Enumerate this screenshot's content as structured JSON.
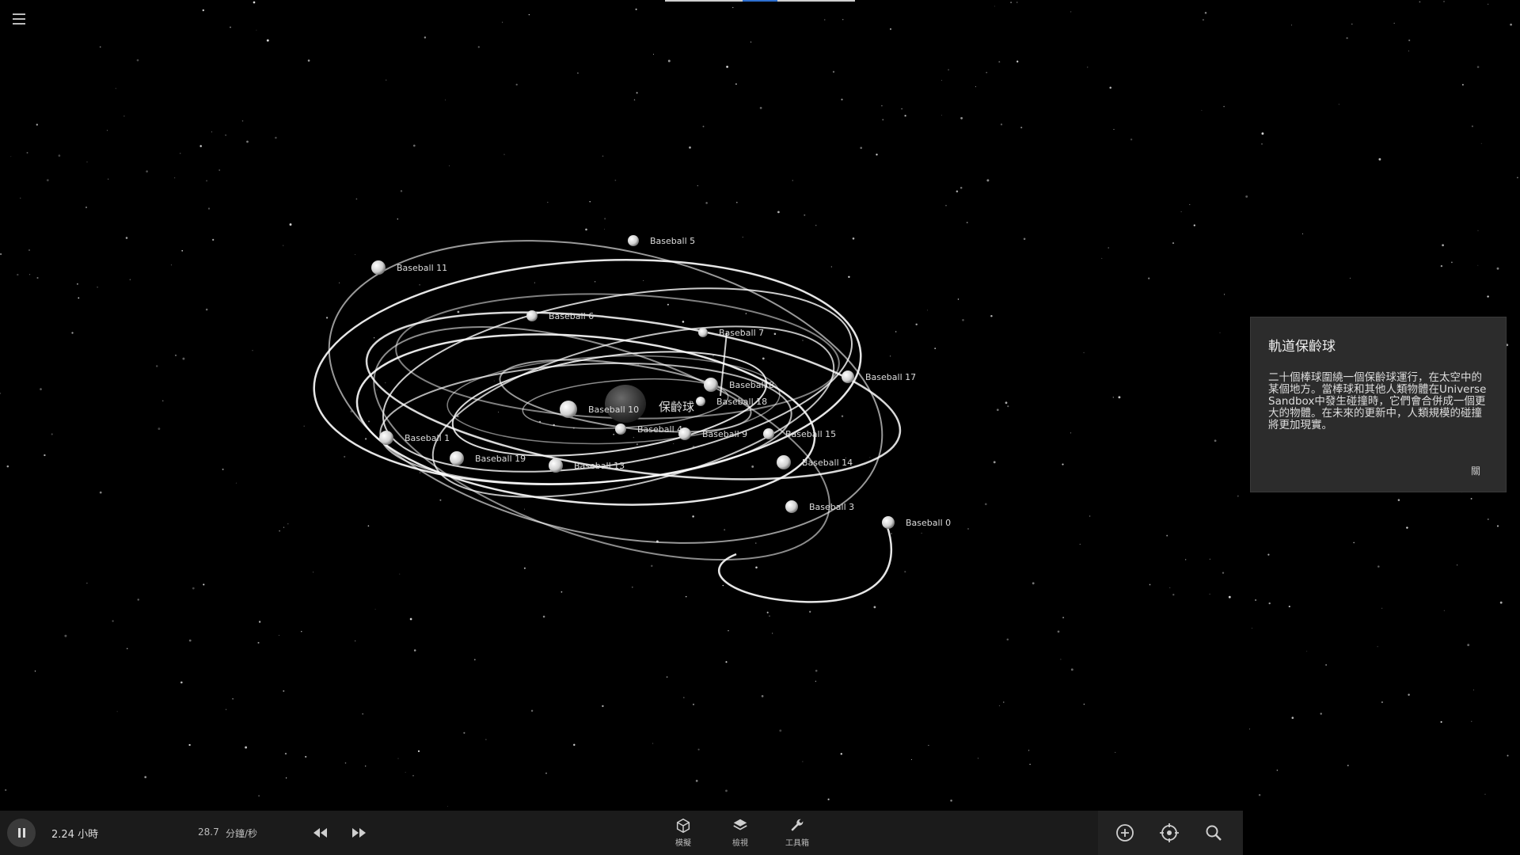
{
  "scene": {
    "central_body": "保齡球",
    "bodies": [
      {
        "name": "Baseball 0"
      },
      {
        "name": "Baseball 1"
      },
      {
        "name": "Baseball 3"
      },
      {
        "name": "Baseball 4"
      },
      {
        "name": "Baseball 5"
      },
      {
        "name": "Baseball 6"
      },
      {
        "name": "Baseball 7"
      },
      {
        "name": "Baseball 8"
      },
      {
        "name": "Baseball 9"
      },
      {
        "name": "Baseball 10"
      },
      {
        "name": "Baseball 11"
      },
      {
        "name": "Baseball 13"
      },
      {
        "name": "Baseball 14"
      },
      {
        "name": "Baseball 15"
      },
      {
        "name": "Baseball 17"
      },
      {
        "name": "Baseball 18"
      },
      {
        "name": "Baseball 19"
      }
    ]
  },
  "info_panel": {
    "title": "軌道保齡球",
    "description": "二十個棒球圍繞一個保齡球運行，在太空中的某個地方。當棒球和其他人類物體在Universe Sandbox中發生碰撞時，它們會合併成一個更大的物體。在未來的更新中，人類規模的碰撞將更加現實。",
    "close_label": "關"
  },
  "bottom_bar": {
    "time_value": "2.24 小時",
    "rate_value": "28.7",
    "rate_unit": "分鐘/秒",
    "nav": [
      {
        "label": "模擬",
        "icon": "cube-icon"
      },
      {
        "label": "檢視",
        "icon": "layers-icon"
      },
      {
        "label": "工具箱",
        "icon": "wrench-icon"
      }
    ],
    "tools": [
      "add-icon",
      "focus-icon",
      "search-icon"
    ]
  },
  "colors": {
    "background": "#000000",
    "panel": "#2c2c2c",
    "bar": "#1b1b1b",
    "accent": "#2e6fd0",
    "orbit": "#ffffff"
  }
}
